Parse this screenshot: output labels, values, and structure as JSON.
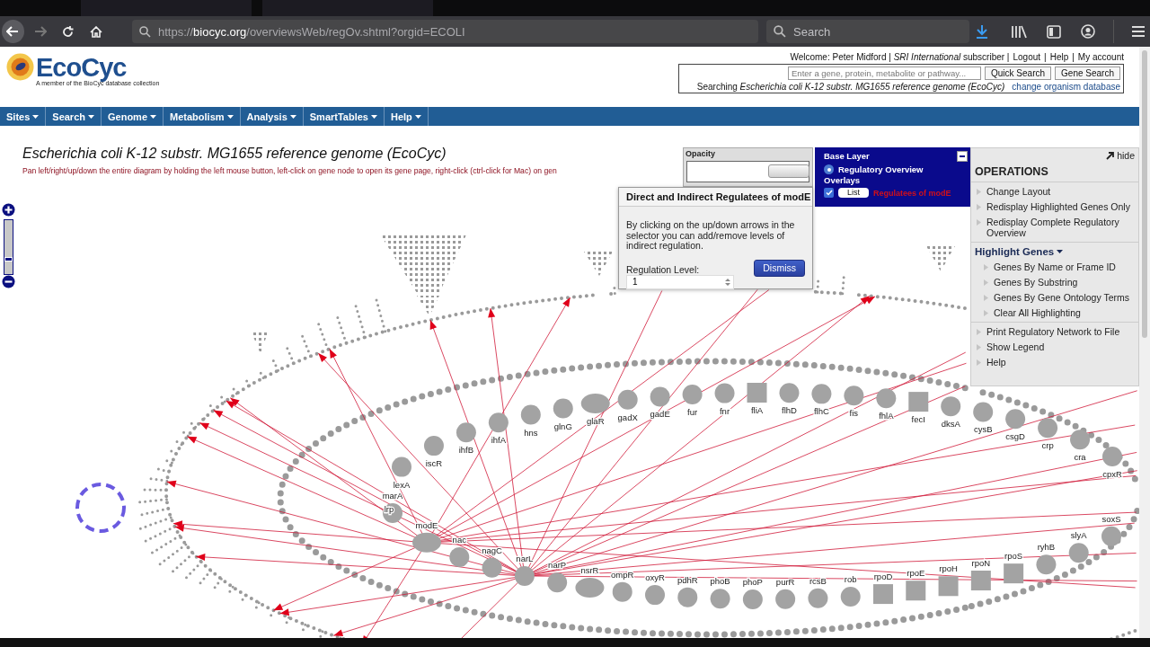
{
  "browser": {
    "url": "https://**biocyc.org**/overviewsWeb/regOv.shtml?orgid=ECOLI",
    "search_placeholder": "Search"
  },
  "header": {
    "logo": "EcoCyc",
    "tagline": "A member of the BioCyc database collection",
    "welcome": "Welcome: Peter Midford | *SRI International* subscriber |",
    "links": [
      "Logout",
      "Help",
      "My account"
    ],
    "separator": "|",
    "search_placeholder": "Enter a gene, protein, metabolite or pathway...",
    "search_buttons": [
      "Quick Search",
      "Gene Search"
    ],
    "searching": "Searching *Escherichia coli K-12 substr. MG1655 reference genome (EcoCyc)*",
    "change_link": "change organism database"
  },
  "nav": [
    "Sites",
    "Search",
    "Genome",
    "Metabolism",
    "Analysis",
    "SmartTables",
    "Help"
  ],
  "title": "Escherichia coli K-12 substr. MG1655 reference genome (EcoCyc)",
  "instructions": "Pan left/right/up/down the entire diagram by holding the left mouse button, left-click on gene node to open its gene page, right-click (ctrl-click for Mac) on gen",
  "opacity": {
    "label": "Opacity",
    "level": 1
  },
  "layers": {
    "base_title": "Base Layer",
    "base_option": {
      "label": "Regulatory Overview",
      "selected": true
    },
    "overlays_title": "Overlays",
    "overlay": {
      "checked": true,
      "button": "List",
      "name": "Regulatees of modE"
    }
  },
  "dialog": {
    "title": "Direct and Indirect Regulatees of modE",
    "body": "By clicking on the up/down arrows in the selector you can add/remove levels of indirect regulation.",
    "level_label": "Regulation Level:",
    "level_value": "1",
    "button": "Dismiss"
  },
  "operations": {
    "hide": "hide",
    "title": "OPERATIONS",
    "items": [
      "Change Layout",
      "Redisplay Highlighted Genes Only",
      "Redisplay Complete Regulatory Overview"
    ],
    "highlight_title": "Highlight Genes",
    "highlight_items": [
      "Genes By Name or Frame ID",
      "Genes By Substring",
      "Genes By Gene Ontology Terms",
      "Clear All Highlighting"
    ],
    "more_items": [
      "Print Regulatory Network to File",
      "Show Legend",
      "Help"
    ]
  },
  "diagram": {
    "top_genes": [
      {
        "label": "lexA",
        "kind": "circle",
        "regulator": false
      },
      {
        "label": "iscR",
        "kind": "circle",
        "regulator": false
      },
      {
        "label": "ihfB",
        "kind": "circle",
        "regulator": false
      },
      {
        "label": "ihfA",
        "kind": "circle",
        "regulator": false
      },
      {
        "label": "hns",
        "kind": "circle",
        "regulator": false
      },
      {
        "label": "glnG",
        "kind": "circle",
        "regulator": false
      },
      {
        "label": "glaR",
        "kind": "ellipse",
        "regulator": false
      },
      {
        "label": "gadX",
        "kind": "circle",
        "regulator": false
      },
      {
        "label": "gadE",
        "kind": "circle",
        "regulator": false
      },
      {
        "label": "fur",
        "kind": "circle",
        "regulator": false
      },
      {
        "label": "fnr",
        "kind": "circle",
        "regulator": false
      },
      {
        "label": "fliA",
        "kind": "square",
        "regulator": false
      },
      {
        "label": "flhD",
        "kind": "circle",
        "regulator": false
      },
      {
        "label": "flhC",
        "kind": "circle",
        "regulator": false
      },
      {
        "label": "fis",
        "kind": "circle",
        "regulator": false
      },
      {
        "label": "fhlA",
        "kind": "circle",
        "regulator": false
      },
      {
        "label": "fecI",
        "kind": "square",
        "regulator": false
      },
      {
        "label": "dksA",
        "kind": "circle",
        "regulator": false
      },
      {
        "label": "cysB",
        "kind": "circle",
        "regulator": false
      },
      {
        "label": "csgD",
        "kind": "circle",
        "regulator": false
      },
      {
        "label": "crp",
        "kind": "circle",
        "regulator": false
      },
      {
        "label": "cra",
        "kind": "circle",
        "regulator": false
      },
      {
        "label": "cpxR",
        "kind": "circle",
        "regulator": false
      }
    ],
    "left_genes": [
      {
        "label": "marA",
        "kind": "circle",
        "regulator": false
      },
      {
        "label": "lrp",
        "regulator": false
      }
    ],
    "bottom_genes": [
      {
        "label": "modE",
        "kind": "ellipse",
        "regulator": true
      },
      {
        "label": "nac",
        "kind": "circle",
        "regulator": false
      },
      {
        "label": "nagC",
        "kind": "circle",
        "regulator": false
      },
      {
        "label": "narL",
        "kind": "circle",
        "regulator": true
      },
      {
        "label": "narP",
        "kind": "circle",
        "regulator": false
      },
      {
        "label": "nsrR",
        "kind": "ellipse",
        "regulator": false
      },
      {
        "label": "ompR",
        "kind": "circle",
        "regulator": false
      },
      {
        "label": "oxyR",
        "kind": "circle",
        "regulator": false
      },
      {
        "label": "pdhR",
        "kind": "circle",
        "regulator": false
      },
      {
        "label": "phoB",
        "kind": "circle",
        "regulator": false
      },
      {
        "label": "phoP",
        "kind": "circle",
        "regulator": false
      },
      {
        "label": "purR",
        "kind": "circle",
        "regulator": false
      },
      {
        "label": "rcsB",
        "kind": "circle",
        "regulator": false
      },
      {
        "label": "rob",
        "kind": "circle",
        "regulator": false
      },
      {
        "label": "rpoD",
        "kind": "square",
        "regulator": false
      },
      {
        "label": "rpoE",
        "kind": "square",
        "regulator": false
      },
      {
        "label": "rpoH",
        "kind": "square",
        "regulator": false
      },
      {
        "label": "rpoN",
        "kind": "square",
        "regulator": false
      },
      {
        "label": "rpoS",
        "kind": "square",
        "regulator": false
      },
      {
        "label": "ryhB",
        "kind": "circle",
        "regulator": false
      },
      {
        "label": "slyA",
        "kind": "circle",
        "regulator": false
      },
      {
        "label": "soxS",
        "kind": "circle",
        "regulator": false
      }
    ]
  }
}
